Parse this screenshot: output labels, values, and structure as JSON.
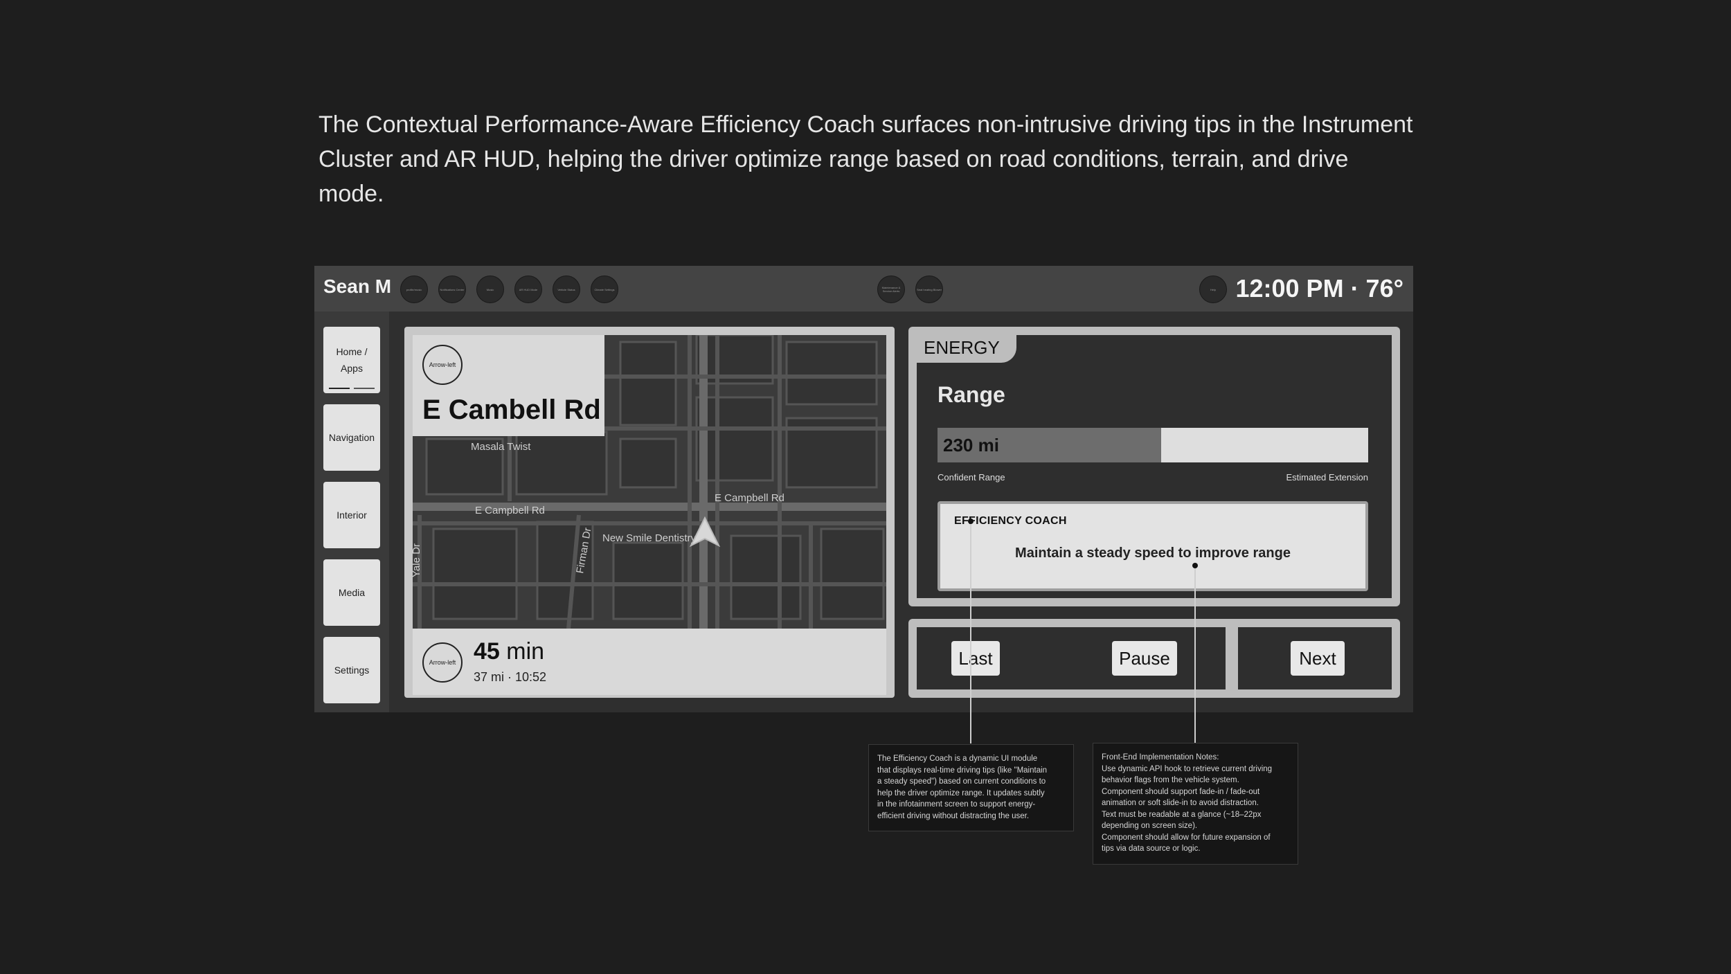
{
  "intro": {
    "text": "The Contextual Performance-Aware Efficiency Coach surfaces non-intrusive driving tips in the Instrument Cluster and AR HUD, helping the driver optimize range based on road conditions, terrain, and drive mode."
  },
  "topbar": {
    "user_name": "Sean M",
    "clock": "12:00 PM · 76°",
    "left_circles": [
      "profile/music",
      "Notifications Center",
      "Music",
      "AR HUD Mode",
      "Vehicle Status",
      "Climate Settings"
    ],
    "center_circles": [
      "Maintenance & Service Alerts",
      "Seat heating Blower"
    ],
    "right_circle": "Help"
  },
  "leftnav": {
    "items": [
      "Home / Apps",
      "Navigation",
      "Interior",
      "Media",
      "Settings"
    ]
  },
  "map": {
    "street_icon": "Arrow-left",
    "street_name": "E Cambell Rd",
    "eta_icon": "Arrow-left",
    "eta_value": "45",
    "eta_unit": "min",
    "eta_details": "37 mi · 10:52",
    "labels": {
      "poi_1": "Masala Twist",
      "road_1": "E Campbell Rd",
      "road_2": "E Campbell Rd",
      "poi_2": "New Smile Dentistry",
      "road_3": "Firman Dr",
      "road_4": "Yale Dr"
    }
  },
  "energy": {
    "tag": "ENERGY",
    "range_title": "Range",
    "range_value": "230 mi",
    "range_fraction": 0.52,
    "left_label": "Confident Range",
    "right_label": "Estimated Extension",
    "coach_title": "EFFICIENCY COACH",
    "coach_tip": "Maintain a steady speed to improve range"
  },
  "controls": {
    "last": "Last",
    "pause": "Pause",
    "next": "Next"
  },
  "notes": {
    "coach_module": [
      "The Efficiency Coach is a dynamic UI module",
      "that displays real-time driving tips (like \"Maintain",
      "a steady speed\") based on current conditions to",
      "help the driver optimize range. It updates subtly",
      "in the infotainment screen to support energy-",
      "efficient driving without distracting the user."
    ],
    "frontend": [
      "Front-End Implementation Notes:",
      "Use dynamic API hook to retrieve current driving",
      "behavior flags from the vehicle system.",
      "Component should support fade-in / fade-out",
      "animation or soft slide-in to avoid distraction.",
      "Text must be readable at a glance (~18–22px",
      "depending on screen size).",
      "Component should allow for future expansion of",
      "tips via data source or logic."
    ]
  }
}
